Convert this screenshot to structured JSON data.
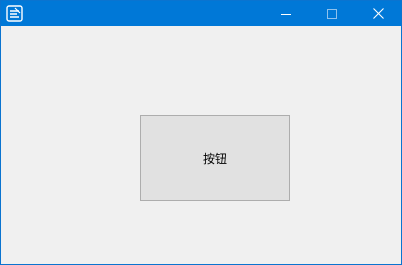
{
  "window": {
    "title": "",
    "titlebar_color": "#0078d7",
    "client_background": "#f0f0f0",
    "icons": {
      "app": "app-logo-icon",
      "minimize": "minimize-icon",
      "maximize": "maximize-icon",
      "close": "close-icon"
    }
  },
  "main": {
    "button_label": "按钮",
    "button_background": "#e1e1e1",
    "button_border": "#adadad"
  }
}
